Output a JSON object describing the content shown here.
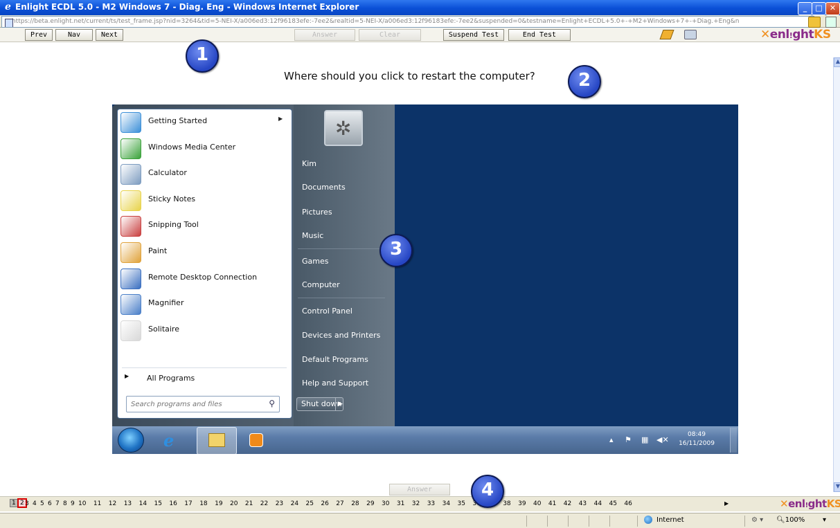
{
  "window": {
    "title": "Enlight ECDL 5.0 - M2 Windows 7 - Diag. Eng - Windows Internet Explorer",
    "url": "https://beta.enlight.net/current/ts/test_frame.jsp?nid=3264&tid=5-NEI-X/a006ed3:12f96183efe:-7ee2&realtid=5-NEI-X/a006ed3:12f96183efe:-7ee2&suspended=0&testname=Enlight+ECDL+5.0+-+M2+Windows+7+-+Diag.+Eng&n"
  },
  "toolbar": {
    "prev": "Prev",
    "nav": "Nav",
    "next": "Next",
    "answer": "Answer",
    "clear": "Clear",
    "suspend": "Suspend Test",
    "end": "End Test",
    "logo_a": "enl",
    "logo_b": "ght",
    "logo_c": "KS"
  },
  "question": "Where should you click to restart the computer?",
  "badges": [
    "1",
    "2",
    "3",
    "4"
  ],
  "start_menu": {
    "programs": [
      {
        "label": "Getting Started",
        "icon": "getting-started-icon",
        "color": "#3b8fd8"
      },
      {
        "label": "Windows Media Center",
        "icon": "media-center-icon",
        "color": "#3aa23a"
      },
      {
        "label": "Calculator",
        "icon": "calculator-icon",
        "color": "#7d9cc0"
      },
      {
        "label": "Sticky Notes",
        "icon": "sticky-notes-icon",
        "color": "#e8d34a"
      },
      {
        "label": "Snipping Tool",
        "icon": "snipping-tool-icon",
        "color": "#c94040"
      },
      {
        "label": "Paint",
        "icon": "paint-icon",
        "color": "#e0a23a"
      },
      {
        "label": "Remote Desktop Connection",
        "icon": "remote-desktop-icon",
        "color": "#3a6fc0"
      },
      {
        "label": "Magnifier",
        "icon": "magnifier-icon",
        "color": "#4a7fc8"
      },
      {
        "label": "Solitaire",
        "icon": "solitaire-icon",
        "color": "#d8d8d8"
      }
    ],
    "all_programs": "All Programs",
    "search_placeholder": "Search programs and files",
    "right_links": [
      "Kim",
      "Documents",
      "Pictures",
      "Music",
      "Games",
      "Computer",
      "Control Panel",
      "Devices and Printers",
      "Default Programs",
      "Help and Support"
    ],
    "shutdown": "Shut down"
  },
  "taskbar": {
    "time": "08:49",
    "date": "16/11/2009"
  },
  "bottom_answer": "Answer",
  "question_numbers": [
    "1",
    "2",
    "3",
    "4",
    "5",
    "6",
    "7",
    "8",
    "9",
    "10",
    "11",
    "12",
    "13",
    "14",
    "15",
    "16",
    "17",
    "18",
    "19",
    "20",
    "21",
    "22",
    "23",
    "24",
    "25",
    "26",
    "27",
    "28",
    "29",
    "30",
    "31",
    "32",
    "33",
    "34",
    "35",
    "36",
    "37",
    "38",
    "39",
    "40",
    "41",
    "42",
    "43",
    "44",
    "45",
    "46"
  ],
  "current_question": "2",
  "status": {
    "zone": "Internet",
    "zoom": "100%"
  },
  "colors": {
    "badge": "#2646c4",
    "current_marker": "#d80000",
    "desktop": "#0c3368"
  }
}
